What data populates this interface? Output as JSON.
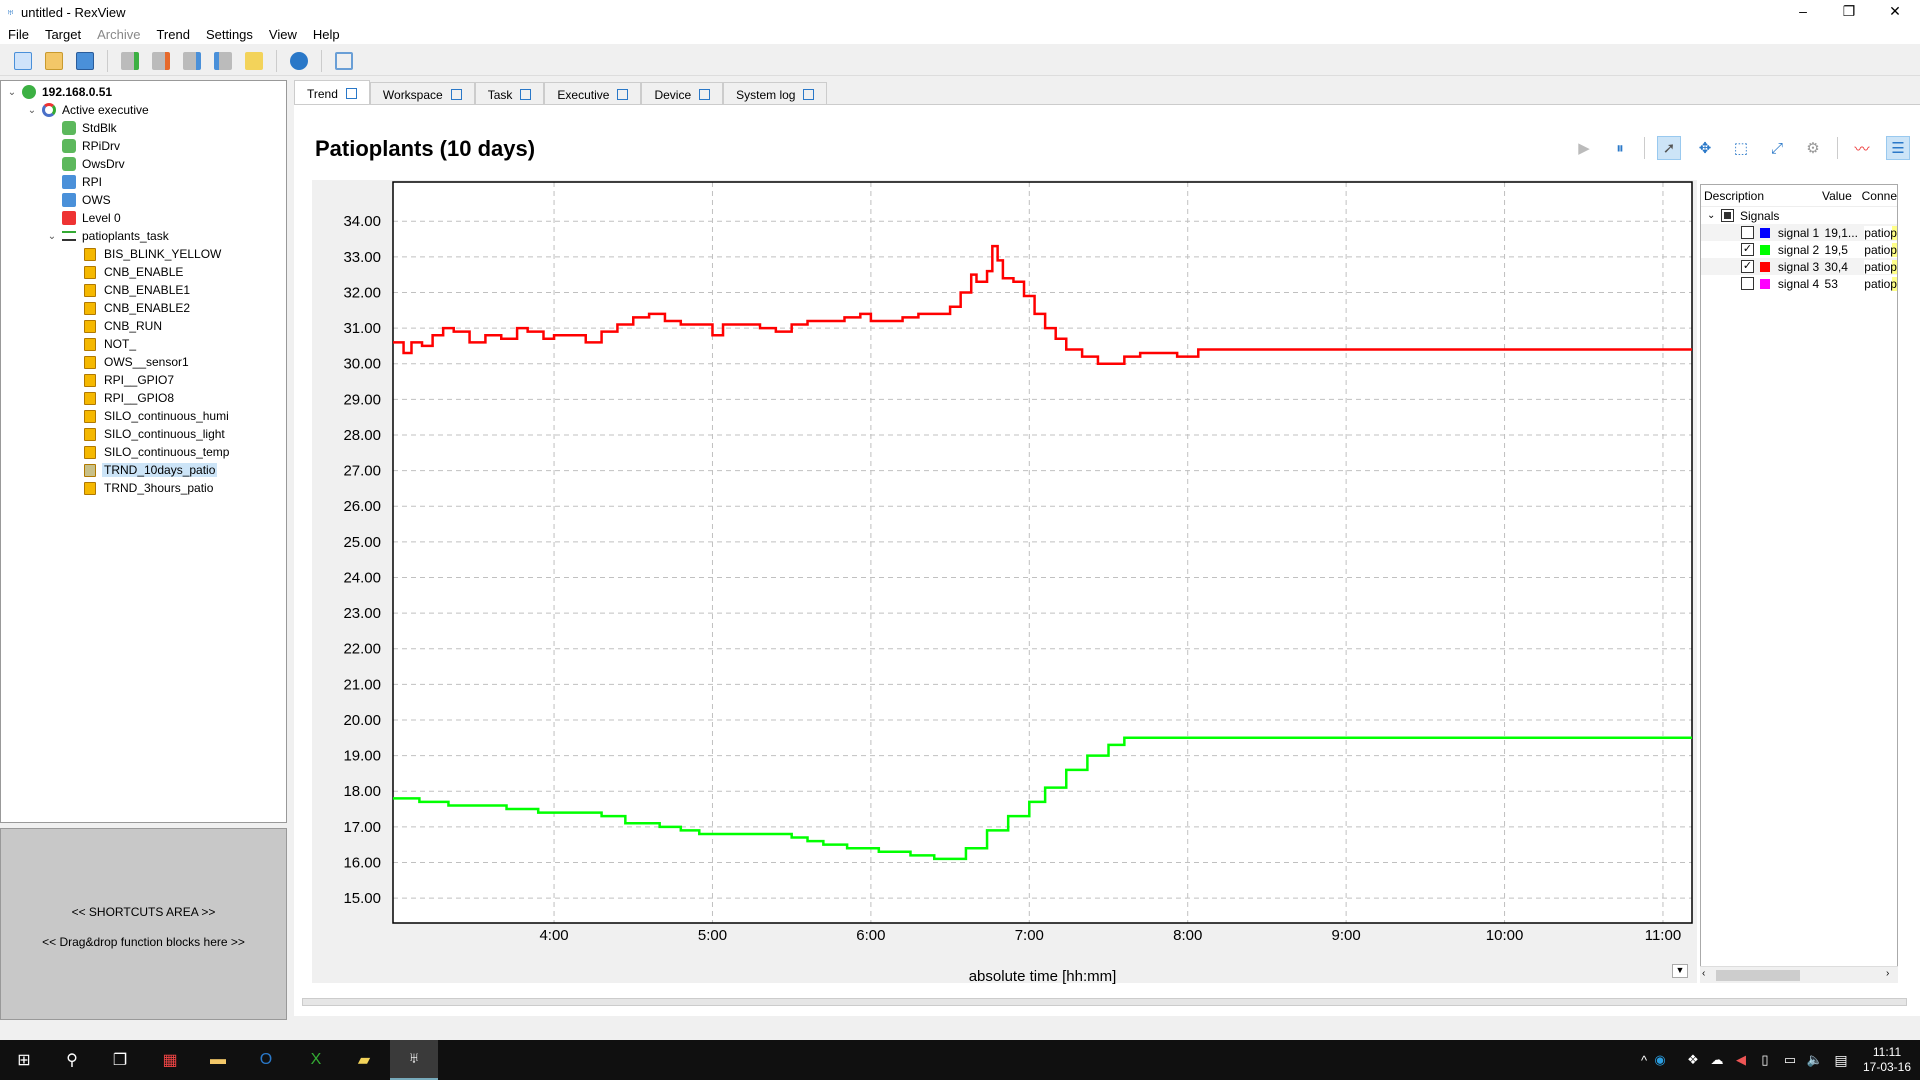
{
  "window": {
    "title": "untitled - RexView",
    "minimize": "–",
    "restore": "❐",
    "close": "✕"
  },
  "menu": [
    "File",
    "Target",
    "Archive",
    "Trend",
    "Settings",
    "View",
    "Help"
  ],
  "tree": {
    "root": "192.168.0.51",
    "executive": "Active executive",
    "modules": [
      "StdBlk",
      "RPiDrv",
      "OwsDrv",
      "RPI",
      "OWS",
      "Level 0"
    ],
    "task": "patioplants_task",
    "blocks": [
      "BIS_BLINK_YELLOW",
      "CNB_ENABLE",
      "CNB_ENABLE1",
      "CNB_ENABLE2",
      "CNB_RUN",
      "NOT_",
      "OWS__sensor1",
      "RPI__GPIO7",
      "RPI__GPIO8",
      "SILO_continuous_humi",
      "SILO_continuous_light",
      "SILO_continuous_temp",
      "TRND_10days_patio",
      "TRND_3hours_patio"
    ],
    "selected": "TRND_10days_patio"
  },
  "shortcuts": {
    "line1": "<< SHORTCUTS AREA >>",
    "line2": "<< Drag&drop function blocks here >>"
  },
  "tabs": [
    "Trend",
    "Workspace",
    "Task",
    "Executive",
    "Device",
    "System log"
  ],
  "active_tab": "Trend",
  "trend": {
    "title": "Patioplants (10 days)"
  },
  "legend": {
    "headers": [
      "Description",
      "Value",
      "Conne"
    ],
    "group": "Signals",
    "signals": [
      {
        "name": "signal 1",
        "value": "19,1...",
        "conn": "patiop",
        "checked": false,
        "color": "#0000ff"
      },
      {
        "name": "signal 2",
        "value": "19,5",
        "conn": "patiop",
        "checked": true,
        "color": "#00ff00"
      },
      {
        "name": "signal 3",
        "value": "30,4",
        "conn": "patiop",
        "checked": true,
        "color": "#ff0000"
      },
      {
        "name": "signal 4",
        "value": "53",
        "conn": "patiop",
        "checked": false,
        "color": "#ff00ff"
      }
    ]
  },
  "taskbar": {
    "time": "11:11",
    "date": "17-03-16"
  },
  "chart_data": {
    "type": "line",
    "title": "",
    "xlabel": "absolute time [hh:mm]",
    "ylabel": "",
    "xlim": [
      "02:59",
      "11:11"
    ],
    "ylim": [
      14.3,
      35.1
    ],
    "xticks": [
      "4:00",
      "5:00",
      "6:00",
      "7:00",
      "8:00",
      "9:00",
      "10:00",
      "11:00"
    ],
    "yticks": [
      "15.00",
      "16.00",
      "17.00",
      "18.00",
      "19.00",
      "20.00",
      "21.00",
      "22.00",
      "23.00",
      "24.00",
      "25.00",
      "26.00",
      "27.00",
      "28.00",
      "29.00",
      "30.00",
      "31.00",
      "32.00",
      "33.00",
      "34.00"
    ],
    "grid": true,
    "step": true,
    "series": [
      {
        "name": "signal 3",
        "color": "#ff0000",
        "points": [
          [
            "02:59",
            30.6
          ],
          [
            "03:03",
            30.3
          ],
          [
            "03:06",
            30.6
          ],
          [
            "03:10",
            30.5
          ],
          [
            "03:14",
            30.8
          ],
          [
            "03:18",
            31.0
          ],
          [
            "03:22",
            30.9
          ],
          [
            "03:28",
            30.6
          ],
          [
            "03:34",
            30.8
          ],
          [
            "03:40",
            30.7
          ],
          [
            "03:46",
            31.0
          ],
          [
            "03:50",
            30.9
          ],
          [
            "03:56",
            30.7
          ],
          [
            "04:00",
            30.8
          ],
          [
            "04:06",
            30.8
          ],
          [
            "04:12",
            30.6
          ],
          [
            "04:18",
            30.9
          ],
          [
            "04:24",
            31.1
          ],
          [
            "04:30",
            31.3
          ],
          [
            "04:36",
            31.4
          ],
          [
            "04:42",
            31.2
          ],
          [
            "04:48",
            31.1
          ],
          [
            "04:54",
            31.1
          ],
          [
            "05:00",
            30.8
          ],
          [
            "05:04",
            31.1
          ],
          [
            "05:10",
            31.1
          ],
          [
            "05:18",
            31.0
          ],
          [
            "05:24",
            30.9
          ],
          [
            "05:30",
            31.1
          ],
          [
            "05:36",
            31.2
          ],
          [
            "05:42",
            31.2
          ],
          [
            "05:50",
            31.3
          ],
          [
            "05:56",
            31.4
          ],
          [
            "06:00",
            31.2
          ],
          [
            "06:06",
            31.2
          ],
          [
            "06:12",
            31.3
          ],
          [
            "06:18",
            31.4
          ],
          [
            "06:24",
            31.4
          ],
          [
            "06:30",
            31.6
          ],
          [
            "06:34",
            32.0
          ],
          [
            "06:38",
            32.5
          ],
          [
            "06:40",
            32.3
          ],
          [
            "06:44",
            32.6
          ],
          [
            "06:46",
            33.3
          ],
          [
            "06:48",
            32.9
          ],
          [
            "06:50",
            32.4
          ],
          [
            "06:54",
            32.3
          ],
          [
            "06:58",
            31.9
          ],
          [
            "07:02",
            31.4
          ],
          [
            "07:06",
            31.0
          ],
          [
            "07:10",
            30.7
          ],
          [
            "07:14",
            30.4
          ],
          [
            "07:20",
            30.2
          ],
          [
            "07:26",
            30.0
          ],
          [
            "07:30",
            30.0
          ],
          [
            "07:36",
            30.2
          ],
          [
            "07:42",
            30.3
          ],
          [
            "07:50",
            30.3
          ],
          [
            "07:56",
            30.2
          ],
          [
            "08:04",
            30.4
          ],
          [
            "11:11",
            30.4
          ]
        ]
      },
      {
        "name": "signal 2",
        "color": "#00ff00",
        "points": [
          [
            "02:59",
            17.8
          ],
          [
            "03:09",
            17.7
          ],
          [
            "03:20",
            17.6
          ],
          [
            "03:42",
            17.5
          ],
          [
            "03:54",
            17.4
          ],
          [
            "04:18",
            17.3
          ],
          [
            "04:27",
            17.1
          ],
          [
            "04:40",
            17.0
          ],
          [
            "04:48",
            16.9
          ],
          [
            "04:55",
            16.8
          ],
          [
            "05:30",
            16.7
          ],
          [
            "05:36",
            16.6
          ],
          [
            "05:42",
            16.5
          ],
          [
            "05:51",
            16.4
          ],
          [
            "06:03",
            16.3
          ],
          [
            "06:15",
            16.2
          ],
          [
            "06:24",
            16.1
          ],
          [
            "06:30",
            16.1
          ],
          [
            "06:36",
            16.4
          ],
          [
            "06:44",
            16.9
          ],
          [
            "06:52",
            17.3
          ],
          [
            "07:00",
            17.7
          ],
          [
            "07:06",
            18.1
          ],
          [
            "07:14",
            18.6
          ],
          [
            "07:22",
            19.0
          ],
          [
            "07:30",
            19.3
          ],
          [
            "07:36",
            19.5
          ],
          [
            "11:11",
            19.5
          ]
        ]
      }
    ]
  }
}
